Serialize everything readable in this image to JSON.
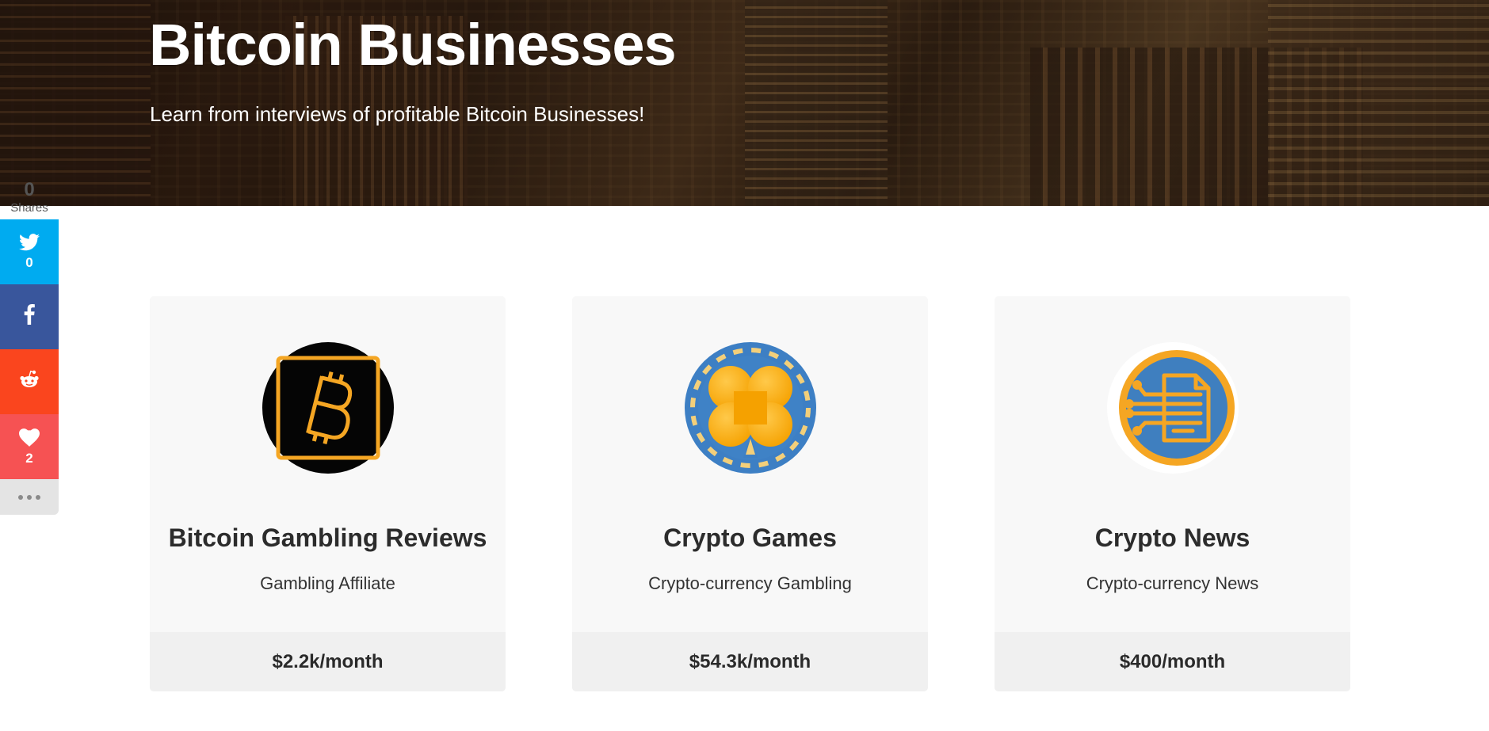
{
  "hero": {
    "title": "Bitcoin Businesses",
    "subtitle": "Learn from interviews of profitable Bitcoin Businesses!"
  },
  "share": {
    "total": "0",
    "total_label": "Shares",
    "buttons": [
      {
        "network": "twitter",
        "icon": "twitter-icon",
        "count": "0",
        "color": "#00abf0"
      },
      {
        "network": "facebook",
        "icon": "facebook-icon",
        "count": "",
        "color": "#39569c"
      },
      {
        "network": "reddit",
        "icon": "reddit-icon",
        "count": "",
        "color": "#fa451e"
      },
      {
        "network": "love",
        "icon": "heart-icon",
        "count": "2",
        "color": "#f65253"
      }
    ],
    "more_icon": "more-dots-icon"
  },
  "businesses": [
    {
      "name": "Bitcoin Gambling Reviews",
      "category": "Gambling Affiliate",
      "revenue": "$2.2k/month",
      "icon": "bitcoin-logo-icon"
    },
    {
      "name": "Crypto Games",
      "category": "Crypto-currency Gambling",
      "revenue": "$54.3k/month",
      "icon": "poker-chip-club-icon"
    },
    {
      "name": "Crypto News",
      "category": "Crypto-currency News",
      "revenue": "$400/month",
      "icon": "digital-news-icon"
    }
  ],
  "colors": {
    "card_bg": "#f8f8f8",
    "card_footer_bg": "#f0f0f0",
    "accent_orange": "#f5a623",
    "accent_blue": "#3f7fbf"
  }
}
